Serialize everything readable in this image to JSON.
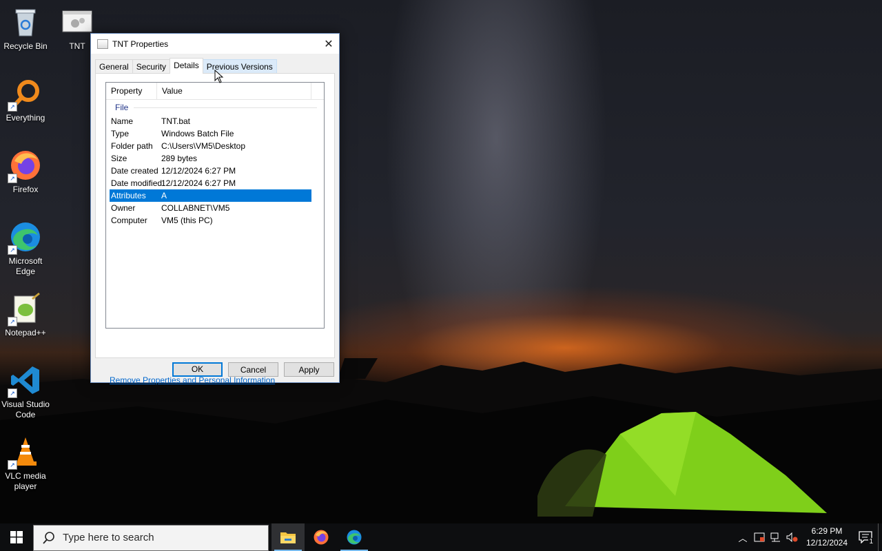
{
  "desktop": {
    "icons": [
      {
        "label": "Recycle Bin"
      },
      {
        "label": "TNT"
      },
      {
        "label": "Everything"
      },
      {
        "label": "Firefox"
      },
      {
        "label": "Microsoft Edge"
      },
      {
        "label": "Notepad++"
      },
      {
        "label": "Visual Studio Code"
      },
      {
        "label": "VLC media player"
      }
    ]
  },
  "dialog": {
    "title": "TNT Properties",
    "close_glyph": "✕",
    "tabs": [
      "General",
      "Security",
      "Details",
      "Previous Versions"
    ],
    "active_tab": "Details",
    "columns": {
      "property": "Property",
      "value": "Value"
    },
    "group": "File",
    "rows": [
      {
        "k": "Name",
        "v": "TNT.bat"
      },
      {
        "k": "Type",
        "v": "Windows Batch File"
      },
      {
        "k": "Folder path",
        "v": "C:\\Users\\VM5\\Desktop"
      },
      {
        "k": "Size",
        "v": "289 bytes"
      },
      {
        "k": "Date created",
        "v": "12/12/2024 6:27 PM"
      },
      {
        "k": "Date modified",
        "v": "12/12/2024 6:27 PM"
      },
      {
        "k": "Attributes",
        "v": "A"
      },
      {
        "k": "Owner",
        "v": "COLLABNET\\VM5"
      },
      {
        "k": "Computer",
        "v": "VM5 (this PC)"
      }
    ],
    "selected_row": "Attributes",
    "link": "Remove Properties and Personal Information",
    "buttons": {
      "ok": "OK",
      "cancel": "Cancel",
      "apply": "Apply"
    }
  },
  "taskbar": {
    "search_placeholder": "Type here to search",
    "time": "6:29 PM",
    "date": "12/12/2024",
    "notification_count": "1",
    "accent": "#0078d7"
  }
}
